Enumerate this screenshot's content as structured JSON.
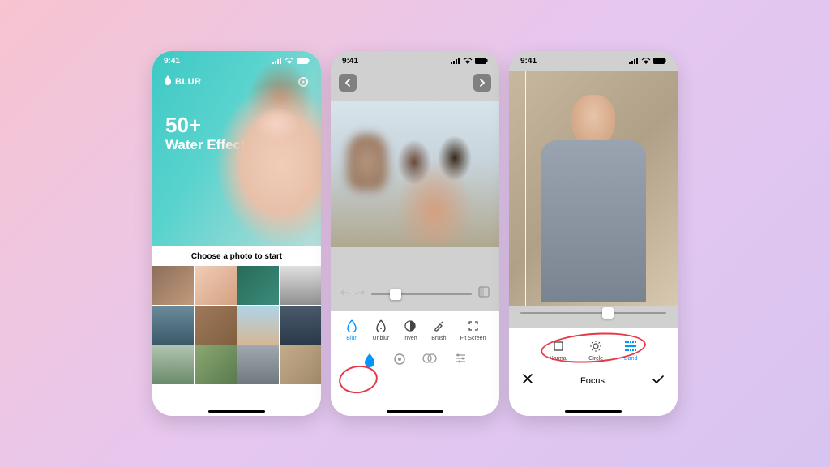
{
  "status": {
    "time": "9:41"
  },
  "phone1": {
    "brand": "BLUR",
    "headline_count": "50+",
    "headline_text": "Water Effects",
    "choose_label": "Choose a photo to start"
  },
  "phone2": {
    "tools": [
      {
        "label": "Blur",
        "icon": "droplet-outline-icon",
        "active": true
      },
      {
        "label": "Unblur",
        "icon": "droplet-plus-icon",
        "active": false
      },
      {
        "label": "Invert",
        "icon": "contrast-icon",
        "active": false
      },
      {
        "label": "Brush",
        "icon": "brush-icon",
        "active": false
      },
      {
        "label": "Fit Screen",
        "icon": "fit-screen-icon",
        "active": false
      }
    ],
    "modes": [
      {
        "icon": "droplet-fill-icon",
        "active": true
      },
      {
        "icon": "circle-dot-icon",
        "active": false
      },
      {
        "icon": "overlap-icon",
        "active": false
      },
      {
        "icon": "sliders-icon",
        "active": false
      }
    ],
    "slider_value": 24
  },
  "phone3": {
    "focus_modes": [
      {
        "label": "Normal",
        "icon": "square-icon",
        "active": false
      },
      {
        "label": "Circle",
        "icon": "sun-icon",
        "active": false
      },
      {
        "label": "Band",
        "icon": "band-icon",
        "active": true
      }
    ],
    "title": "Focus",
    "slider_value": 60
  }
}
